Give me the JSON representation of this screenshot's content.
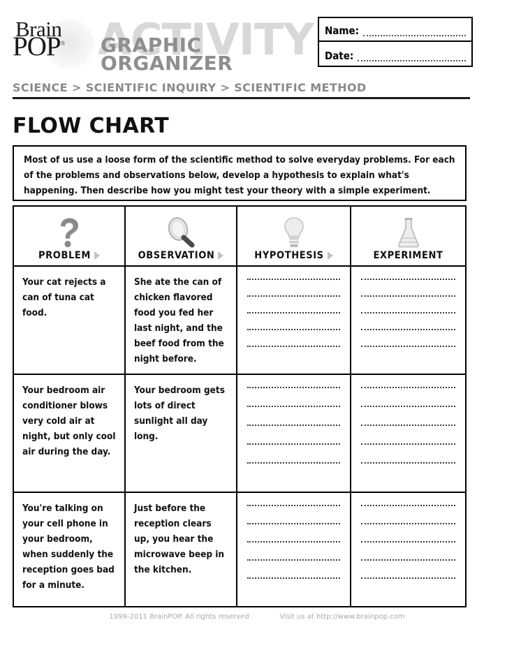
{
  "header": {
    "logo": {
      "brain": "Brain",
      "pop": "POP",
      "registered": "®"
    },
    "watermark": "ACTIVITY",
    "graphic": "GRAPHIC",
    "organizer": "ORGANIZER",
    "breadcrumb": "SCIENCE > SCIENTIFIC INQUIRY > SCIENTIFIC METHOD",
    "name_label": "Name:",
    "date_label": "Date:"
  },
  "page_title": "FLOW CHART",
  "intro": "Most of us use a loose form of the scientific method to solve everyday problems. For each of the problems and observations below, develop a hypothesis to explain what's happening. Then describe how you might test your theory with a simple experiment.",
  "table": {
    "columns": [
      {
        "label": "PROBLEM",
        "icon": "question-mark-icon",
        "arrow": true
      },
      {
        "label": "OBSERVATION",
        "icon": "magnifying-glass-icon",
        "arrow": true
      },
      {
        "label": "HYPOTHESIS",
        "icon": "lightbulb-icon",
        "arrow": true
      },
      {
        "label": "EXPERIMENT",
        "icon": "flask-icon",
        "arrow": false
      }
    ],
    "rows": [
      {
        "problem": "Your cat rejects a can of tuna cat food.",
        "observation": "She ate the can of chicken flavored food you fed her last night, and the beef food from the night before.",
        "hypothesis": "",
        "experiment": "",
        "blank_lines": 5
      },
      {
        "problem": "Your bedroom air conditioner blows very cold air at night, but only cool air during the day.",
        "observation": "Your bedroom gets lots of direct sunlight all day long.",
        "hypothesis": "",
        "experiment": "",
        "blank_lines": 5
      },
      {
        "problem": "You're talking on your cell phone in your bedroom, when suddenly the reception goes bad for a minute.",
        "observation": "Just before the reception clears up, you hear the microwave beep in the kitchen.",
        "hypothesis": "",
        "experiment": "",
        "blank_lines": 5
      }
    ]
  },
  "footer": {
    "copyright": "1999-2011 BrainPOP. All rights reserved",
    "visit": "Visit us at http://www.brainpop.com"
  },
  "colors": {
    "ink": "#111111",
    "watermark_gray": "#d8d8d8",
    "breadcrumb_gray": "#8a8a8a",
    "footer_gray": "#a8a8a8"
  }
}
